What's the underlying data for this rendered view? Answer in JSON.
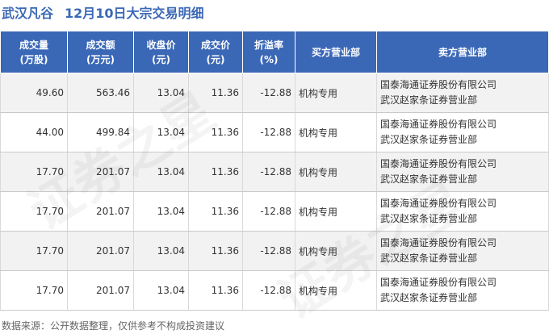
{
  "header": {
    "stock_name": "武汉凡谷",
    "subtitle": "12月10日大宗交易明细"
  },
  "table": {
    "columns": [
      {
        "line1": "成交量",
        "line2": "(万股)"
      },
      {
        "line1": "成交额",
        "line2": "(万元)"
      },
      {
        "line1": "收盘价",
        "line2": "(元)"
      },
      {
        "line1": "成交价",
        "line2": "(元)"
      },
      {
        "line1": "折溢率",
        "line2": "(%)"
      },
      {
        "line1": "买方营业部",
        "line2": ""
      },
      {
        "line1": "卖方营业部",
        "line2": ""
      }
    ],
    "rows": [
      {
        "volume": "49.60",
        "amount": "563.46",
        "close": "13.04",
        "price": "11.36",
        "premium": "-12.88",
        "buyer": "机构专用",
        "seller_line1": "国泰海通证券股份有限公司",
        "seller_line2": "武汉赵家条证券营业部"
      },
      {
        "volume": "44.00",
        "amount": "499.84",
        "close": "13.04",
        "price": "11.36",
        "premium": "-12.88",
        "buyer": "机构专用",
        "seller_line1": "国泰海通证券股份有限公司",
        "seller_line2": "武汉赵家条证券营业部"
      },
      {
        "volume": "17.70",
        "amount": "201.07",
        "close": "13.04",
        "price": "11.36",
        "premium": "-12.88",
        "buyer": "机构专用",
        "seller_line1": "国泰海通证券股份有限公司",
        "seller_line2": "武汉赵家条证券营业部"
      },
      {
        "volume": "17.70",
        "amount": "201.07",
        "close": "13.04",
        "price": "11.36",
        "premium": "-12.88",
        "buyer": "机构专用",
        "seller_line1": "国泰海通证券股份有限公司",
        "seller_line2": "武汉赵家条证券营业部"
      },
      {
        "volume": "17.70",
        "amount": "201.07",
        "close": "13.04",
        "price": "11.36",
        "premium": "-12.88",
        "buyer": "机构专用",
        "seller_line1": "国泰海通证券股份有限公司",
        "seller_line2": "武汉赵家条证券营业部"
      },
      {
        "volume": "17.70",
        "amount": "201.07",
        "close": "13.04",
        "price": "11.36",
        "premium": "-12.88",
        "buyer": "机构专用",
        "seller_line1": "国泰海通证券股份有限公司",
        "seller_line2": "武汉赵家条证券营业部"
      }
    ]
  },
  "footer": {
    "source": "数据来源：公开数据整理，仅供参考不构成投资建议"
  },
  "watermark": {
    "text": "证券之星"
  },
  "colors": {
    "header_bg": "#3b68b6",
    "title": "#3b68b6",
    "row_alt": "#f2f2f2",
    "negative": "#2f9c4a"
  }
}
